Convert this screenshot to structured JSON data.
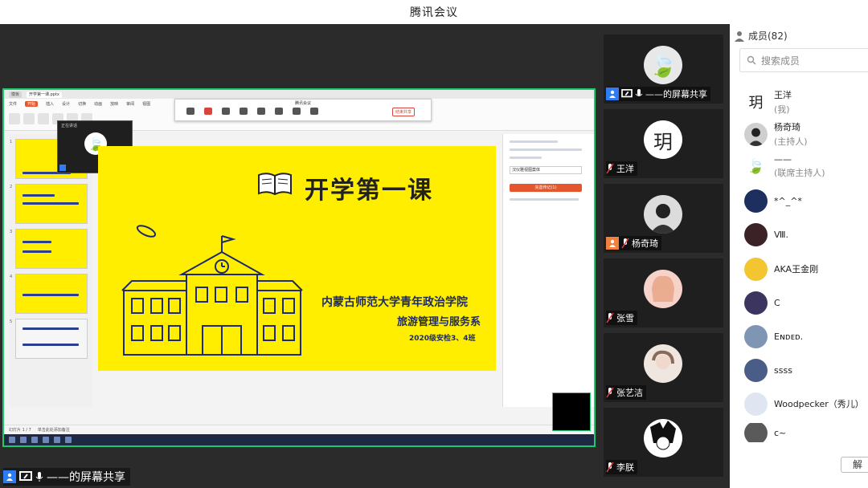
{
  "app": {
    "title": "腾讯会议"
  },
  "share": {
    "presenter_label": "——的屏幕共享",
    "ppt_tabs": [
      "模板",
      "开学第一课.pptx"
    ],
    "ribbon": [
      "文件",
      "开始",
      "插入",
      "设计",
      "切换",
      "动画",
      "放映",
      "审阅",
      "视图"
    ],
    "meeting_bar": {
      "title": "腾讯会议",
      "end": "结束共享"
    },
    "floating_cam_name": "正在讲话",
    "slide": {
      "title": "开学第一课",
      "school": "内蒙古师范大学青年政治学院",
      "dept": "旅游管理与服务系",
      "class": "2020级安检3、4班"
    },
    "right_panel": {
      "field": "汉仪雅视图案体",
      "button": "完善传记(1)"
    },
    "status_text": "幻灯片 1 / 7",
    "bottom_note": "单击此处添加备注"
  },
  "tiles": [
    {
      "name": "——的屏幕共享",
      "avatar": "bamboo-icon",
      "host": true
    },
    {
      "name": "王洋",
      "avatar": "calligraphy-icon"
    },
    {
      "name": "杨奇琦",
      "avatar": "person-icon",
      "host": true
    },
    {
      "name": "张雪",
      "avatar": "girl-icon"
    },
    {
      "name": "张艺洁",
      "avatar": "girl2-icon"
    },
    {
      "name": "李朕",
      "avatar": "anime-icon"
    }
  ],
  "sidebar": {
    "header": "成员(82)",
    "search_placeholder": "搜索成员",
    "members": [
      {
        "name": "王洋",
        "role": "(我)",
        "avatar": "calligraphy"
      },
      {
        "name": "杨奇琦",
        "role": "(主持人)",
        "avatar": "person"
      },
      {
        "name": "——",
        "role": "(联席主持人)",
        "avatar": "bamboo"
      },
      {
        "name": "*^_^*",
        "role": "",
        "avatar": "dark-blue"
      },
      {
        "name": "Ⅷ.",
        "role": "",
        "avatar": "portrait"
      },
      {
        "name": "AKA王金刚",
        "role": "",
        "avatar": "spongebob"
      },
      {
        "name": "C",
        "role": "",
        "avatar": "dark-purple"
      },
      {
        "name": "Eɴᴅᴇᴅ.",
        "role": "",
        "avatar": "blue-gray"
      },
      {
        "name": "ssss",
        "role": "",
        "avatar": "sky"
      },
      {
        "name": "Woodpecker（秀儿）",
        "role": "",
        "avatar": "cute"
      },
      {
        "name": "c~",
        "role": "",
        "avatar": "grey"
      }
    ],
    "bottom_button": "解"
  }
}
